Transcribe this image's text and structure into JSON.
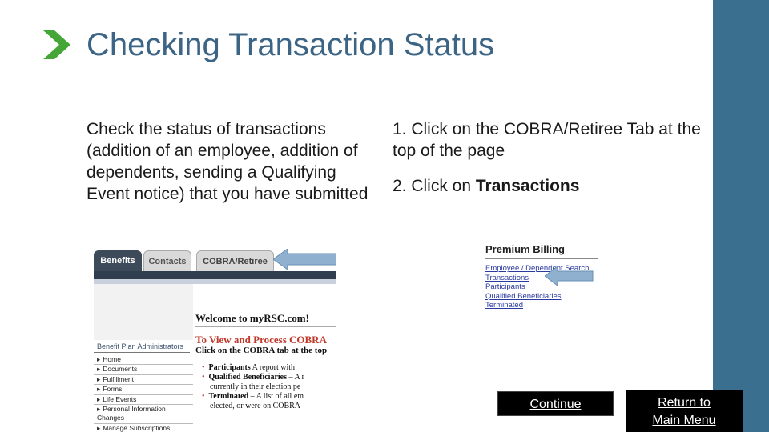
{
  "slide": {
    "title": "Checking Transaction Status",
    "description": "Check the status of transactions (addition of an employee, addition of dependents, sending a Qualifying Event notice) that you have submitted",
    "step1": "1. Click on the COBRA/Retiree Tab at the top of the page",
    "step2_prefix": "2. Click on ",
    "step2_bold": "Transactions"
  },
  "left_screenshot": {
    "tabs": [
      "Benefits",
      "Contacts",
      "COBRA/Retiree"
    ],
    "welcome": "Welcome to myRSC.com!",
    "to_view": "To View and Process COBRA",
    "click_cobra": "Click on the COBRA tab at the top",
    "bullets": [
      {
        "bold": "Participants",
        "text": "  A report with"
      },
      {
        "bold": "Qualified Beneficiaries",
        "text": " – A r"
      },
      {
        "bold": "",
        "text": "currently in their election pe"
      },
      {
        "bold": "Terminated",
        "text": " – A list of all em"
      },
      {
        "bold": "",
        "text": "elected, or were on COBRA"
      }
    ],
    "bpa_title": "Benefit Plan Administrators",
    "menu": [
      "Home",
      "Documents",
      "Fulfillment",
      "Forms",
      "Life Events",
      "Personal Information",
      "Changes",
      "Manage Subscriptions"
    ]
  },
  "right_screenshot": {
    "title": "Premium Billing",
    "links": [
      "Employee / Dependent Search",
      "Transactions",
      "Participants",
      "Qualified Beneficiaries",
      "Terminated"
    ]
  },
  "buttons": {
    "continue": "Continue",
    "return_line1": "Return to",
    "return_line2": "Main Menu"
  },
  "colors": {
    "accent_green": "#43a637",
    "title_blue": "#3c6485",
    "sidebar": "#3a6f8f",
    "arrow": "#8fb0cf"
  }
}
